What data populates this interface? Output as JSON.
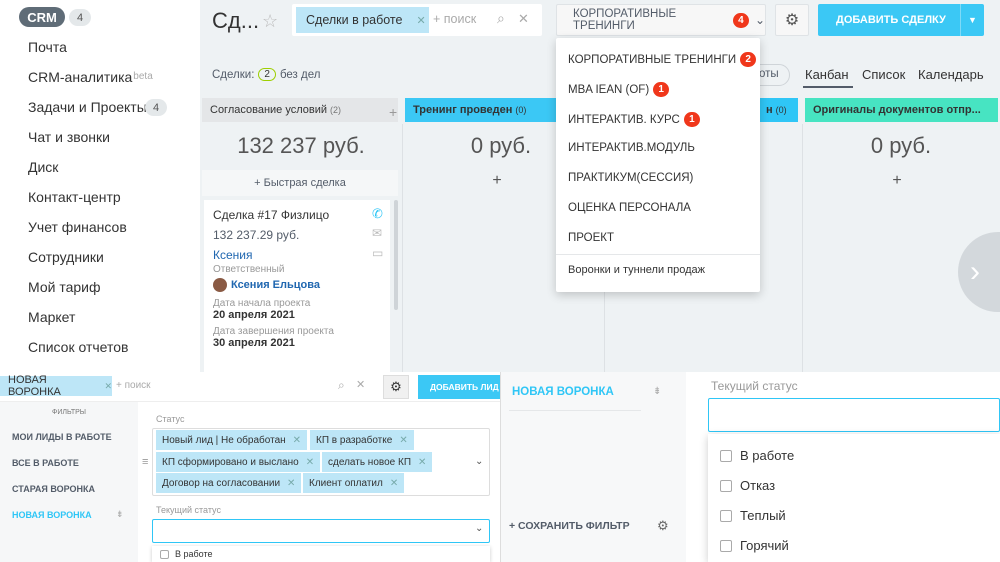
{
  "top": {
    "crm_badge": "CRM",
    "crm_count": "4",
    "menu": [
      {
        "label": "Почта"
      },
      {
        "label": "CRM-аналитика",
        "beta": "beta"
      },
      {
        "label": "Задачи и Проекты",
        "count": "4"
      },
      {
        "label": "Чат и звонки"
      },
      {
        "label": "Диск"
      },
      {
        "label": "Контакт-центр"
      },
      {
        "label": "Учет финансов"
      },
      {
        "label": "Сотрудники"
      },
      {
        "label": "Мой тариф"
      },
      {
        "label": "Маркет"
      },
      {
        "label": "Список отчетов"
      }
    ],
    "page_title": "Сд...",
    "search_tag": "Сделки в работе",
    "search_placeholder": "+ поиск",
    "funnel_label": "КОРПОРАТИВНЫЕ ТРЕНИНГИ",
    "funnel_count": "4",
    "add_deal": "ДОБАВИТЬ СДЕЛКУ",
    "deals_label": "Сделки:",
    "deals_count": "2",
    "no_tasks": "без дел",
    "extra_btn": "оты",
    "view_tabs": [
      "Канбан",
      "Список",
      "Календарь"
    ],
    "stages": [
      {
        "name": "Согласование условий",
        "count": "(2)",
        "color": "#e4e6e8",
        "sum": "132 237 руб."
      },
      {
        "name": "Тренинг проведен",
        "count": "(0)",
        "color": "#3bc8f5",
        "sum": "0 руб."
      },
      {
        "name": "н",
        "count": "(0)",
        "color": "#2fc6f6",
        "sum": ""
      },
      {
        "name": "Оригиналы документов отпр...",
        "count": "(0)",
        "color": "#47e4c2",
        "sum": "0 руб."
      }
    ],
    "quick_deal": "+ Быстрая сделка",
    "deal": {
      "title": "Сделка #17 Физлицо",
      "amount": "132 237.29 руб.",
      "contact": "Ксения",
      "resp_label": "Ответственный",
      "resp_name": "Ксения Ельцова",
      "start_label": "Дата начала проекта",
      "start_value": "20 апреля 2021",
      "end_label": "Дата завершения проекта",
      "end_value": "30 апреля 2021"
    },
    "dropdown": [
      {
        "label": "КОРПОРАТИВНЫЕ ТРЕНИНГИ",
        "count": "2"
      },
      {
        "label": "MBA IEAN (OF)",
        "count": "1"
      },
      {
        "label": "ИНТЕРАКТИВ. КУРС",
        "count": "1"
      },
      {
        "label": "ИНТЕРАКТИВ.МОДУЛЬ",
        "count": ""
      },
      {
        "label": "ПРАКТИКУМ(СЕССИЯ)",
        "count": ""
      },
      {
        "label": "ОЦЕНКА ПЕРСОНАЛА",
        "count": ""
      },
      {
        "label": "ПРОЕКТ",
        "count": ""
      }
    ],
    "dropdown_footer": "Воронки и туннели продаж"
  },
  "bottom_left": {
    "search_tag": "НОВАЯ ВОРОНКА",
    "search_placeholder": "+ поиск",
    "add_lead": "ДОБАВИТЬ ЛИД",
    "filters_title": "ФИЛЬТРЫ",
    "filters": [
      "МОИ ЛИДЫ В РАБОТЕ",
      "ВСЕ В РАБОТЕ",
      "СТАРАЯ ВОРОНКА",
      "НОВАЯ ВОРОНКА"
    ],
    "status_label": "Статус",
    "chips": [
      "Новый лид | Не обработан",
      "КП в разработке",
      "КП сформировано и выслано",
      "сделать новое КП",
      "Договор на согласовании",
      "Клиент оплатил"
    ],
    "current_status_label": "Текущий статус",
    "first_option": "В работе"
  },
  "bottom_mid": {
    "title": "НОВАЯ ВОРОНКА",
    "save_filter": "+ СОХРАНИТЬ ФИЛЬТР"
  },
  "bottom_right": {
    "label": "Текущий статус",
    "options": [
      "В работе",
      "Отказ",
      "Теплый",
      "Горячий"
    ]
  }
}
